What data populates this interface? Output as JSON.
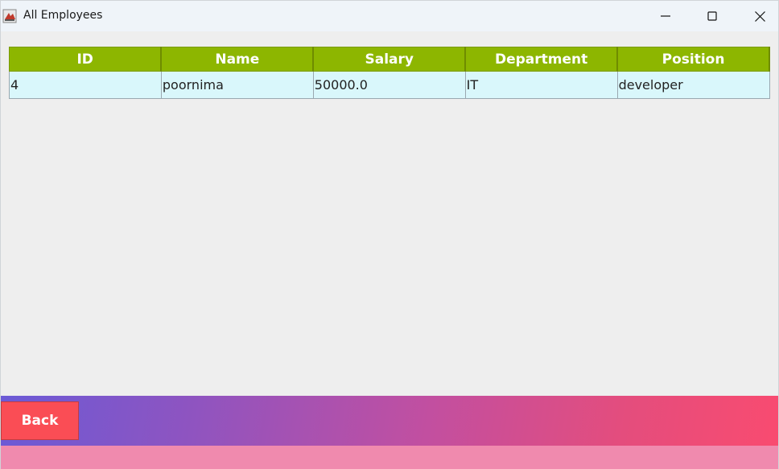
{
  "window": {
    "title": "All Employees",
    "controls": [
      "minimize-icon",
      "maximize-icon",
      "close-icon"
    ]
  },
  "table": {
    "headers": [
      "ID",
      "Name",
      "Salary",
      "Department",
      "Position"
    ],
    "rows": [
      [
        "4",
        "poornima",
        "50000.0",
        "IT",
        "developer"
      ]
    ]
  },
  "footer": {
    "back_label": "Back"
  },
  "colors": {
    "header_bg": "#8db600",
    "row_bg": "#d9f7fb",
    "back_button": "#fa4d55",
    "gradient_start": "#6b5ad6",
    "gradient_end": "#f94b70",
    "bottom_strip": "#f08aae"
  }
}
